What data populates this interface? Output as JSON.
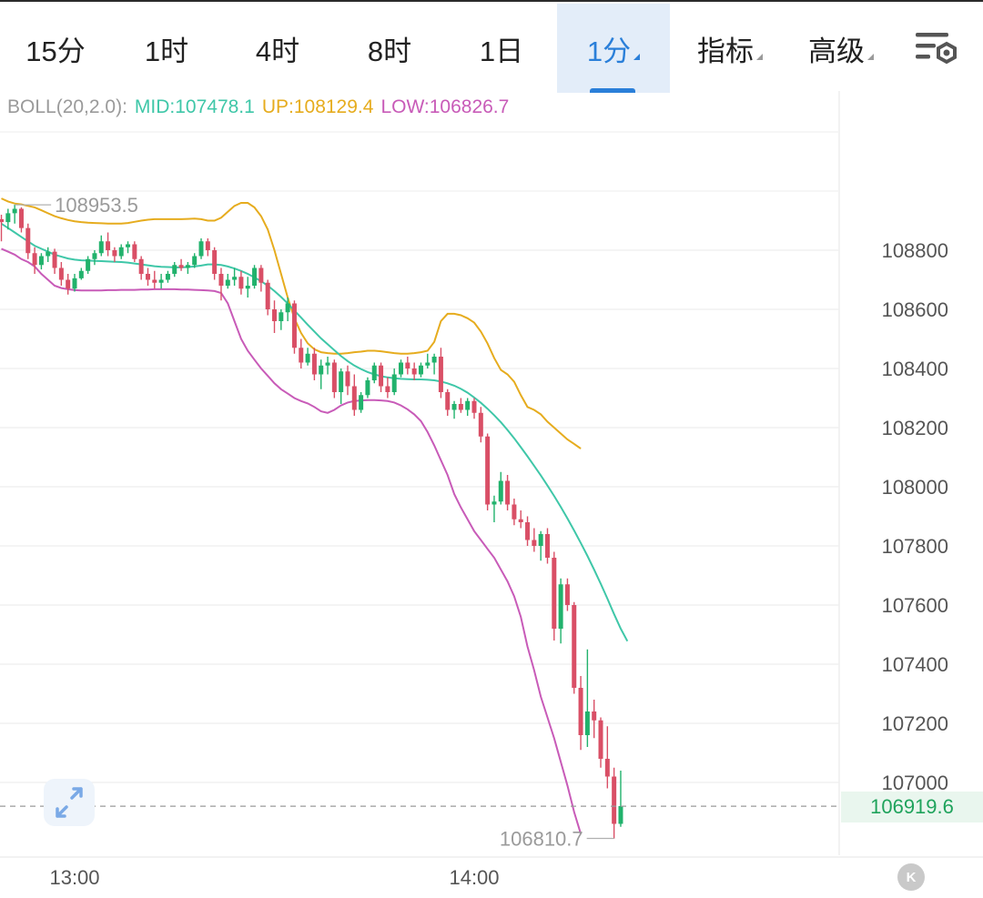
{
  "toolbar": {
    "tabs": [
      {
        "label": "15分"
      },
      {
        "label": "1时"
      },
      {
        "label": "4时"
      },
      {
        "label": "8时"
      },
      {
        "label": "1日"
      },
      {
        "label": "1分",
        "active": true,
        "dropdown": true
      },
      {
        "label": "指标",
        "dropdown": true
      },
      {
        "label": "高级",
        "dropdown": true
      }
    ],
    "settings_icon": "chart-settings-icon"
  },
  "indicator": {
    "name": "BOLL(20,2.0):",
    "mid": "MID:107478.1",
    "up": "UP:108129.4",
    "low": "LOW:106826.7"
  },
  "chart_data": {
    "type": "candlestick",
    "y_range": [
      106700,
      109200
    ],
    "y_ticks": [
      108800,
      108600,
      108400,
      108200,
      108000,
      107800,
      107600,
      107400,
      107200,
      107000
    ],
    "y_tick_labels": [
      "108800",
      "108600",
      "108400",
      "108200",
      "108000",
      "107800",
      "107600",
      "107400",
      "107200",
      "107000"
    ],
    "x_ticks": [
      {
        "label": "13:00",
        "minute": 0
      },
      {
        "label": "14:00",
        "minute": 60
      }
    ],
    "x_range_minutes": [
      -12,
      88
    ],
    "high_marker": {
      "label": "108953.5",
      "value": 108953.5
    },
    "low_marker": {
      "label": "106810.7",
      "value": 106810.7
    },
    "last_price": {
      "label": "106919.6",
      "value": 106919.6
    },
    "colors": {
      "up": "#21b26c",
      "down": "#d94f66",
      "mid": "#3fc7a8",
      "upper": "#e6ac1e",
      "lower": "#c85bb8"
    },
    "candles": [
      [
        108905,
        108920,
        108830,
        108895
      ],
      [
        108895,
        108940,
        108870,
        108925
      ],
      [
        108925,
        108954,
        108890,
        108940
      ],
      [
        108940,
        108945,
        108860,
        108875
      ],
      [
        108875,
        108890,
        108770,
        108790
      ],
      [
        108790,
        108810,
        108720,
        108750
      ],
      [
        108750,
        108790,
        108735,
        108780
      ],
      [
        108780,
        108810,
        108760,
        108795
      ],
      [
        108795,
        108805,
        108720,
        108740
      ],
      [
        108740,
        108760,
        108680,
        108700
      ],
      [
        108700,
        108720,
        108650,
        108670
      ],
      [
        108670,
        108720,
        108660,
        108705
      ],
      [
        108705,
        108740,
        108700,
        108730
      ],
      [
        108730,
        108780,
        108720,
        108770
      ],
      [
        108770,
        108800,
        108750,
        108790
      ],
      [
        108790,
        108850,
        108780,
        108830
      ],
      [
        108830,
        108860,
        108780,
        108800
      ],
      [
        108800,
        108810,
        108760,
        108780
      ],
      [
        108780,
        108820,
        108770,
        108810
      ],
      [
        108810,
        108830,
        108790,
        108820
      ],
      [
        108820,
        108830,
        108760,
        108770
      ],
      [
        108770,
        108780,
        108700,
        108720
      ],
      [
        108720,
        108740,
        108680,
        108700
      ],
      [
        108700,
        108730,
        108670,
        108690
      ],
      [
        108690,
        108720,
        108670,
        108700
      ],
      [
        108700,
        108730,
        108690,
        108720
      ],
      [
        108720,
        108760,
        108710,
        108750
      ],
      [
        108750,
        108770,
        108730,
        108740
      ],
      [
        108740,
        108760,
        108720,
        108750
      ],
      [
        108750,
        108790,
        108740,
        108780
      ],
      [
        108780,
        108840,
        108770,
        108830
      ],
      [
        108830,
        108840,
        108780,
        108800
      ],
      [
        108800,
        108810,
        108700,
        108720
      ],
      [
        108720,
        108740,
        108630,
        108680
      ],
      [
        108680,
        108720,
        108670,
        108700
      ],
      [
        108700,
        108740,
        108680,
        108710
      ],
      [
        108710,
        108730,
        108650,
        108670
      ],
      [
        108670,
        108710,
        108640,
        108680
      ],
      [
        108680,
        108750,
        108670,
        108740
      ],
      [
        108740,
        108750,
        108660,
        108690
      ],
      [
        108690,
        108700,
        108580,
        108600
      ],
      [
        108600,
        108630,
        108520,
        108560
      ],
      [
        108560,
        108600,
        108530,
        108590
      ],
      [
        108590,
        108640,
        108560,
        108620
      ],
      [
        108620,
        108630,
        108450,
        108470
      ],
      [
        108470,
        108500,
        108400,
        108420
      ],
      [
        108420,
        108470,
        108410,
        108450
      ],
      [
        108450,
        108470,
        108360,
        108380
      ],
      [
        108380,
        108430,
        108330,
        108410
      ],
      [
        108410,
        108440,
        108380,
        108420
      ],
      [
        108420,
        108430,
        108300,
        108320
      ],
      [
        108320,
        108400,
        108280,
        108390
      ],
      [
        108390,
        108410,
        108310,
        108340
      ],
      [
        108340,
        108380,
        108240,
        108260
      ],
      [
        108260,
        108320,
        108250,
        108310
      ],
      [
        108310,
        108370,
        108300,
        108360
      ],
      [
        108360,
        108420,
        108350,
        108410
      ],
      [
        108410,
        108420,
        108320,
        108340
      ],
      [
        108340,
        108370,
        108300,
        108320
      ],
      [
        108320,
        108400,
        108310,
        108380
      ],
      [
        108380,
        108430,
        108370,
        108420
      ],
      [
        108420,
        108440,
        108380,
        108400
      ],
      [
        108400,
        108420,
        108360,
        108380
      ],
      [
        108380,
        108420,
        108370,
        108410
      ],
      [
        108410,
        108450,
        108400,
        108420
      ],
      [
        108420,
        108450,
        108380,
        108440
      ],
      [
        108440,
        108470,
        108300,
        108320
      ],
      [
        108320,
        108330,
        108240,
        108260
      ],
      [
        108260,
        108290,
        108230,
        108280
      ],
      [
        108280,
        108300,
        108250,
        108260
      ],
      [
        108260,
        108300,
        108240,
        108290
      ],
      [
        108290,
        108300,
        108230,
        108250
      ],
      [
        108250,
        108270,
        108150,
        108170
      ],
      [
        108170,
        108180,
        107920,
        107940
      ],
      [
        107940,
        107970,
        107880,
        107950
      ],
      [
        107950,
        108050,
        107940,
        108020
      ],
      [
        108020,
        108040,
        107920,
        107940
      ],
      [
        107940,
        107960,
        107870,
        107890
      ],
      [
        107890,
        107920,
        107860,
        107880
      ],
      [
        107880,
        107900,
        107800,
        107820
      ],
      [
        107820,
        107860,
        107780,
        107800
      ],
      [
        107800,
        107850,
        107750,
        107840
      ],
      [
        107840,
        107860,
        107740,
        107760
      ],
      [
        107760,
        107780,
        107480,
        107520
      ],
      [
        107520,
        107690,
        107470,
        107670
      ],
      [
        107670,
        107690,
        107580,
        107600
      ],
      [
        107600,
        107610,
        107300,
        107320
      ],
      [
        107320,
        107360,
        107110,
        107160
      ],
      [
        107160,
        107450,
        107120,
        107240
      ],
      [
        107240,
        107280,
        107150,
        107210
      ],
      [
        107210,
        107220,
        107050,
        107080
      ],
      [
        107080,
        107190,
        106980,
        107020
      ],
      [
        107020,
        107050,
        106810,
        106860
      ],
      [
        106860,
        107040,
        106850,
        106920
      ]
    ],
    "boll_mid": [
      108890,
      108875,
      108860,
      108845,
      108830,
      108815,
      108805,
      108795,
      108785,
      108778,
      108772,
      108768,
      108766,
      108765,
      108764,
      108763,
      108762,
      108761,
      108760,
      108758,
      108755,
      108752,
      108749,
      108746,
      108744,
      108743,
      108742,
      108742,
      108743,
      108745,
      108748,
      108752,
      108752,
      108750,
      108745,
      108738,
      108730,
      108720,
      108708,
      108695,
      108680,
      108662,
      108642,
      108620,
      108596,
      108572,
      108548,
      108525,
      108502,
      108482,
      108462,
      108442,
      108425,
      108410,
      108398,
      108388,
      108380,
      108374,
      108370,
      108367,
      108365,
      108364,
      108363,
      108363,
      108362,
      108360,
      108356,
      108350,
      108342,
      108331,
      108318,
      108302,
      108284,
      108264,
      108242,
      108218,
      108192,
      108164,
      108134,
      108103,
      108071,
      108038,
      108004,
      107969,
      107932,
      107893,
      107852,
      107810,
      107766,
      107720,
      107672,
      107622,
      107570,
      107520,
      107478
    ],
    "boll_up": [
      108975,
      108965,
      108958,
      108955,
      108950,
      108945,
      108935,
      108925,
      108915,
      108908,
      108902,
      108898,
      108895,
      108893,
      108892,
      108891,
      108890,
      108890,
      108890,
      108892,
      108896,
      108900,
      108903,
      108905,
      108905,
      108905,
      108905,
      108905,
      108906,
      108907,
      108905,
      108900,
      108900,
      108910,
      108930,
      108950,
      108960,
      108960,
      108945,
      108915,
      108870,
      108800,
      108720,
      108640,
      108570,
      108520,
      108485,
      108465,
      108455,
      108452,
      108450,
      108450,
      108452,
      108455,
      108457,
      108460,
      108460,
      108458,
      108455,
      108452,
      108450,
      108450,
      108452,
      108455,
      108460,
      108490,
      108560,
      108585,
      108585,
      108580,
      108570,
      108555,
      108525,
      108485,
      108435,
      108395,
      108380,
      108355,
      108310,
      108270,
      108260,
      108245,
      108220,
      108200,
      108180,
      108160,
      108145,
      108129
    ],
    "boll_low": [
      108805,
      108795,
      108785,
      108770,
      108760,
      108745,
      108720,
      108700,
      108680,
      108672,
      108668,
      108665,
      108664,
      108664,
      108664,
      108664,
      108665,
      108665,
      108666,
      108666,
      108666,
      108667,
      108667,
      108668,
      108668,
      108668,
      108668,
      108667,
      108667,
      108666,
      108665,
      108664,
      108662,
      108655,
      108620,
      108560,
      108500,
      108460,
      108430,
      108400,
      108375,
      108350,
      108330,
      108315,
      108300,
      108290,
      108282,
      108270,
      108255,
      108250,
      108260,
      108275,
      108285,
      108290,
      108292,
      108293,
      108293,
      108292,
      108290,
      108285,
      108275,
      108262,
      108245,
      108222,
      108185,
      108140,
      108090,
      108040,
      107975,
      107930,
      107890,
      107850,
      107820,
      107790,
      107760,
      107720,
      107680,
      107630,
      107560,
      107460,
      107380,
      107290,
      107220,
      107150,
      107070,
      106990,
      106900,
      106826
    ]
  }
}
